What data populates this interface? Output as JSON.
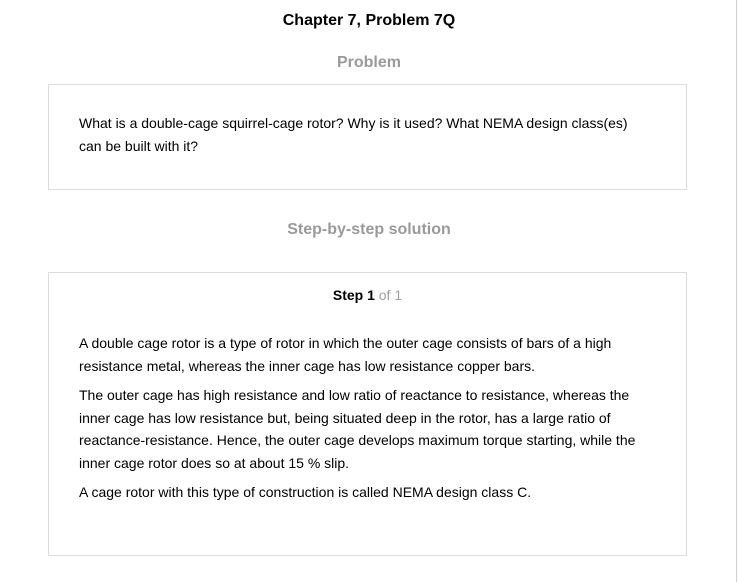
{
  "page": {
    "title": "Chapter 7, Problem 7Q"
  },
  "problem": {
    "heading": "Problem",
    "text": "What is a double-cage squirrel-cage rotor? Why is it used? What NEMA design class(es) can be built with it?"
  },
  "solution": {
    "heading": "Step-by-step solution",
    "step": {
      "label": "Step 1",
      "of_text": "of 1"
    },
    "paragraphs": [
      "A double cage rotor is a type of rotor in which the outer cage consists of bars of a high resistance metal, whereas the inner cage has low resistance copper bars.",
      "The outer cage has high resistance and low ratio of reactance to resistance, whereas the inner cage has low resistance but, being situated deep in the rotor, has a large ratio of reactance-resistance. Hence, the outer cage develops maximum torque starting, while the inner cage rotor does so at about 15 % slip.",
      "A cage rotor with this type of construction is called NEMA design class C."
    ]
  },
  "colors": {
    "heading_gray": "#9a9a9a",
    "border": "#dcdcdc",
    "step_of_gray": "#a0a0a0"
  }
}
